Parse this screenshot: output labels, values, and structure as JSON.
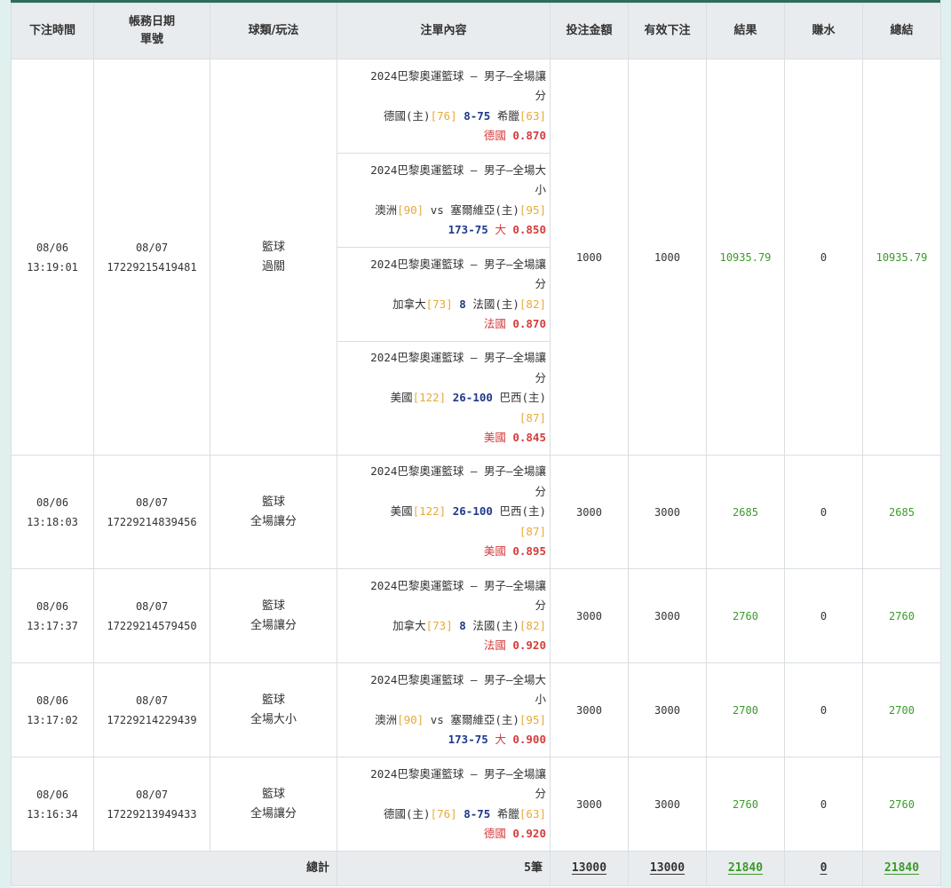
{
  "headers": [
    "下注時間",
    "帳務日期",
    "單號",
    "球類/玩法",
    "注單內容",
    "投注金額",
    "有效下注",
    "結果",
    "賺水",
    "總結"
  ],
  "bets": [
    {
      "time_date": "08/06",
      "time_time": "13:19:01",
      "acct_date": "08/07",
      "ticket": "17229215419481",
      "sport": "籃球",
      "play": "過關",
      "amount": "1000",
      "valid": "1000",
      "result": "10935.79",
      "rebate": "0",
      "total": "10935.79",
      "legs": [
        {
          "l1": "2024巴黎奧運籃球 – 男子–全場讓",
          "l2": "分",
          "team1": "德國(主)",
          "odd1": "[76]",
          "line": "8-75",
          "sep": "",
          "team2": "希臘",
          "odd2": "[63]",
          "pick": "德國",
          "odds": "0.870"
        },
        {
          "l1": "2024巴黎奧運籃球 – 男子–全場大",
          "l2": "小",
          "team1": "澳洲",
          "odd1": "[90]",
          "line": "",
          "sep": "vs",
          "team2": "塞爾維亞(主)",
          "odd2": "[95]",
          "ou_line": "173-75",
          "pick": "大",
          "odds": "0.850"
        },
        {
          "l1": "2024巴黎奧運籃球 – 男子–全場讓",
          "l2": "分",
          "team1": "加拿大",
          "odd1": "[73]",
          "line": "8",
          "sep": "",
          "team2": "法國(主)",
          "odd2": "[82]",
          "pick": "法國",
          "odds": "0.870"
        },
        {
          "l1": "2024巴黎奧運籃球 – 男子–全場讓",
          "l2": "分",
          "team1": "美國",
          "odd1": "[122]",
          "line": "26-100",
          "sep": "",
          "team2": "巴西(主)",
          "odd2": "[87]",
          "pick": "美國",
          "odds": "0.845"
        }
      ]
    },
    {
      "time_date": "08/06",
      "time_time": "13:18:03",
      "acct_date": "08/07",
      "ticket": "17229214839456",
      "sport": "籃球",
      "play": "全場讓分",
      "amount": "3000",
      "valid": "3000",
      "result": "2685",
      "rebate": "0",
      "total": "2685",
      "leg": {
        "l1": "2024巴黎奧運籃球 – 男子–全場讓",
        "l2": "分",
        "team1": "美國",
        "odd1": "[122]",
        "line": "26-100",
        "team2": "巴西(主)",
        "odd2": "[87]",
        "pick": "美國",
        "odds": "0.895"
      }
    },
    {
      "time_date": "08/06",
      "time_time": "13:17:37",
      "acct_date": "08/07",
      "ticket": "17229214579450",
      "sport": "籃球",
      "play": "全場讓分",
      "amount": "3000",
      "valid": "3000",
      "result": "2760",
      "rebate": "0",
      "total": "2760",
      "leg": {
        "l1": "2024巴黎奧運籃球 – 男子–全場讓",
        "l2": "分",
        "team1": "加拿大",
        "odd1": "[73]",
        "line": "8",
        "team2": "法國(主)",
        "odd2": "[82]",
        "pick": "法國",
        "odds": "0.920"
      }
    },
    {
      "time_date": "08/06",
      "time_time": "13:17:02",
      "acct_date": "08/07",
      "ticket": "17229214229439",
      "sport": "籃球",
      "play": "全場大小",
      "amount": "3000",
      "valid": "3000",
      "result": "2700",
      "rebate": "0",
      "total": "2700",
      "leg": {
        "l1": "2024巴黎奧運籃球 – 男子–全場大",
        "l2": "小",
        "team1": "澳洲",
        "odd1": "[90]",
        "sep": "vs",
        "team2": "塞爾維亞(主)",
        "odd2": "[95]",
        "ou_line": "173-75",
        "pick": "大",
        "odds": "0.900"
      }
    },
    {
      "time_date": "08/06",
      "time_time": "13:16:34",
      "acct_date": "08/07",
      "ticket": "17229213949433",
      "sport": "籃球",
      "play": "全場讓分",
      "amount": "3000",
      "valid": "3000",
      "result": "2760",
      "rebate": "0",
      "total": "2760",
      "leg": {
        "l1": "2024巴黎奧運籃球 – 男子–全場讓",
        "l2": "分",
        "team1": "德國(主)",
        "odd1": "[76]",
        "line": "8-75",
        "team2": "希臘",
        "odd2": "[63]",
        "pick": "德國",
        "odds": "0.920"
      }
    }
  ],
  "totals": {
    "label": "總計",
    "count": "5筆",
    "amount": "13000",
    "valid": "13000",
    "result": "21840",
    "rebate": "0",
    "total": "21840"
  },
  "colors": {
    "header_bg": "#e9ecef",
    "win": "#3b9a2a",
    "odds": "#d63c3c",
    "line": "#1e3a8a",
    "bracket": "#e8a93a"
  }
}
